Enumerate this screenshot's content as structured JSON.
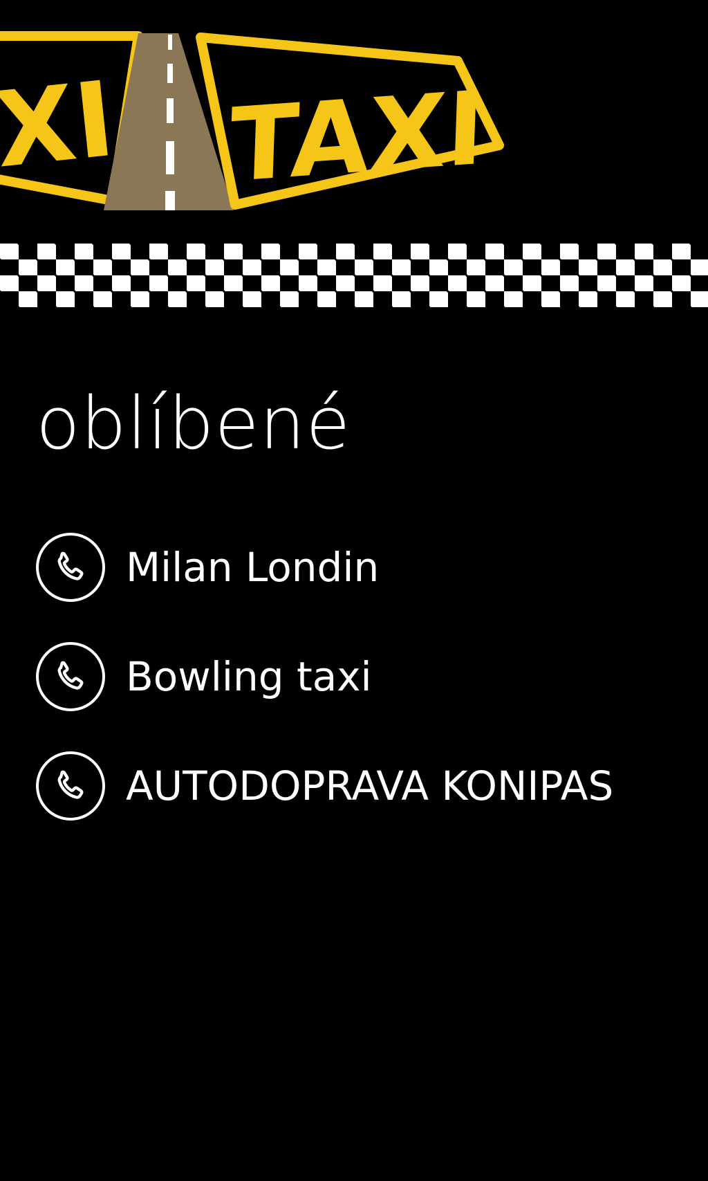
{
  "logo": {
    "text_left": "XI",
    "text_right": "TAXI",
    "colors": {
      "yellow": "#f5c518",
      "road": "#8b7755",
      "lane": "#ffffff"
    }
  },
  "page": {
    "title": "oblíbené"
  },
  "favorites": [
    {
      "label": "Milan Londin",
      "icon": "phone-icon"
    },
    {
      "label": "Bowling taxi",
      "icon": "phone-icon"
    },
    {
      "label": "AUTODOPRAVA KONIPAS",
      "icon": "phone-icon"
    }
  ],
  "colors": {
    "background": "#000000",
    "text": "#ffffff"
  }
}
